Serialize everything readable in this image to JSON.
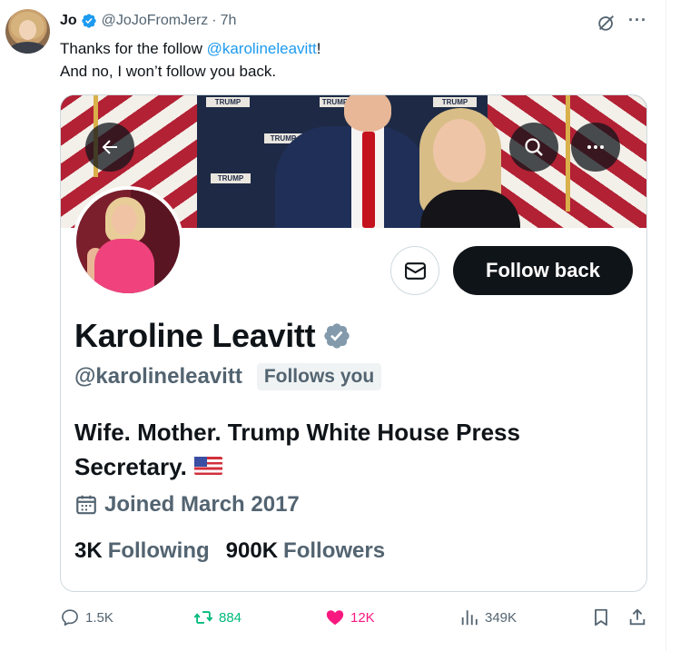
{
  "tweet": {
    "author_name": "Jo",
    "author_handle": "@JoJoFromJerz",
    "separator": "·",
    "time": "7h",
    "text_line1_pre": "Thanks for the follow ",
    "text_line1_mention": "@karolineleavitt",
    "text_line1_post": "!",
    "text_line2": "And no, I won’t follow you back."
  },
  "card": {
    "banner_signs": [
      "TRUMP",
      "TRUMP",
      "TRUMP",
      "TRUMP",
      "TRUMP"
    ],
    "profile_name": "Karoline Leavitt",
    "profile_handle": "@karolineleavitt",
    "follows_you_label": "Follows you",
    "follow_back_label": "Follow back",
    "bio": "Wife. Mother. Trump White House Press Secretary.",
    "joined": "Joined March 2017",
    "following_count": "3K",
    "following_label": "Following",
    "followers_count": "900K",
    "followers_label": "Followers"
  },
  "actions": {
    "replies": "1.5K",
    "reposts": "884",
    "likes": "12K",
    "views": "349K"
  },
  "icons": {
    "verified": "verified-badge-icon",
    "grok": "grok-icon",
    "more": "more-icon",
    "back": "back-arrow-icon",
    "search": "search-icon",
    "message": "envelope-icon",
    "calendar": "calendar-icon",
    "reply": "reply-icon",
    "repost": "repost-icon",
    "like": "heart-icon",
    "views": "views-icon",
    "bookmark": "bookmark-icon",
    "share": "share-icon"
  },
  "colors": {
    "text_primary": "#0f1419",
    "text_secondary": "#536471",
    "link": "#1d9bf0",
    "verified_blue": "#1d9bf0",
    "verified_gray": "#829aab",
    "repost_green": "#00ba7c",
    "like_pink": "#f91880",
    "border": "#cfd9de"
  }
}
